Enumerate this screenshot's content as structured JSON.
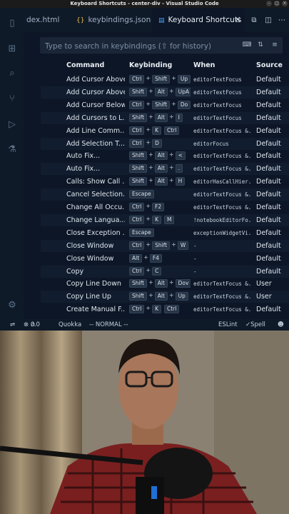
{
  "window": {
    "title": "Keyboard Shortcuts - center-div - Visual Studio Code"
  },
  "tabs": [
    {
      "label": "dex.html",
      "icon": "html-file-icon"
    },
    {
      "label": "keybindings.json",
      "icon": "json-file-icon"
    },
    {
      "label": "Keyboard Shortcuts",
      "icon": "keyboard-shortcuts-icon",
      "active": true
    }
  ],
  "search": {
    "placeholder": "Type to search in keybindings (⇧ for history)"
  },
  "columns": {
    "command": "Command",
    "keybinding": "Keybinding",
    "when": "When",
    "source": "Source"
  },
  "rows": [
    {
      "command": "Add Cursor Above",
      "keys": [
        [
          "Ctrl",
          "Shift",
          "Up"
        ]
      ],
      "when": "editorTextFocus",
      "source": "Default"
    },
    {
      "command": "Add Cursor Above",
      "keys": [
        [
          "Shift",
          "Alt",
          "UpA"
        ]
      ],
      "when": "editorTextFocus",
      "source": "Default"
    },
    {
      "command": "Add Cursor Below",
      "keys": [
        [
          "Ctrl",
          "Shift",
          "Do"
        ]
      ],
      "when": "editorTextFocus",
      "source": "Default"
    },
    {
      "command": "Add Cursors to L...",
      "keys": [
        [
          "Shift",
          "Alt",
          "I"
        ]
      ],
      "when": "editorTextFocus",
      "source": "Default"
    },
    {
      "command": "Add Line Comm...",
      "keys": [
        [
          "Ctrl",
          "K"
        ],
        [
          "Ctrl"
        ]
      ],
      "when": "editorTextFocus &...",
      "source": "Default"
    },
    {
      "command": "Add Selection T...",
      "keys": [
        [
          "Ctrl",
          "D"
        ]
      ],
      "when": "editorFocus",
      "source": "Default"
    },
    {
      "command": "Auto Fix...",
      "keys": [
        [
          "Shift",
          "Alt",
          "<"
        ]
      ],
      "when": "editorTextFocus &...",
      "source": "Default"
    },
    {
      "command": "Auto Fix...",
      "keys": [
        [
          "Shift",
          "Alt",
          "."
        ]
      ],
      "when": "editorTextFocus &...",
      "source": "Default"
    },
    {
      "command": "Calls: Show Call ...",
      "keys": [
        [
          "Shift",
          "Alt",
          "H"
        ]
      ],
      "when": "editorHasCallHier...",
      "source": "Default"
    },
    {
      "command": "Cancel Selection...",
      "keys": [
        [
          "Escape"
        ]
      ],
      "when": "editorTextFocus &...",
      "source": "Default"
    },
    {
      "command": "Change All Occu...",
      "keys": [
        [
          "Ctrl",
          "F2"
        ]
      ],
      "when": "editorTextFocus &...",
      "source": "Default"
    },
    {
      "command": "Change Langua...",
      "keys": [
        [
          "Ctrl",
          "K"
        ],
        [
          "M"
        ]
      ],
      "when": "!notebookEditorFo...",
      "source": "Default"
    },
    {
      "command": "Close Exception ...",
      "keys": [
        [
          "Escape"
        ]
      ],
      "when": "exceptionWidgetVi...",
      "source": "Default"
    },
    {
      "command": "Close Window",
      "keys": [
        [
          "Ctrl",
          "Shift",
          "W"
        ]
      ],
      "when": "-",
      "source": "Default"
    },
    {
      "command": "Close Window",
      "keys": [
        [
          "Alt",
          "F4"
        ]
      ],
      "when": "-",
      "source": "Default"
    },
    {
      "command": "Copy",
      "keys": [
        [
          "Ctrl",
          "C"
        ]
      ],
      "when": "-",
      "source": "Default"
    },
    {
      "command": "Copy Line Down",
      "keys": [
        [
          "Shift",
          "Alt",
          "Dov"
        ]
      ],
      "when": "editorTextFocus &...",
      "source": "User"
    },
    {
      "command": "Copy Line Up",
      "keys": [
        [
          "Shift",
          "Alt",
          "Up"
        ]
      ],
      "when": "editorTextFocus &...",
      "source": "User"
    },
    {
      "command": "Create Manual F...",
      "keys": [
        [
          "Ctrl",
          "K"
        ],
        [
          "Ctrl"
        ]
      ],
      "when": "editorTextFocus &...",
      "source": "Default"
    }
  ],
  "status": {
    "errors": "0",
    "warnings": "0",
    "quokka": "Quokka",
    "mode": "-- NORMAL --",
    "eslint": "ESLint",
    "spell": "Spell"
  }
}
